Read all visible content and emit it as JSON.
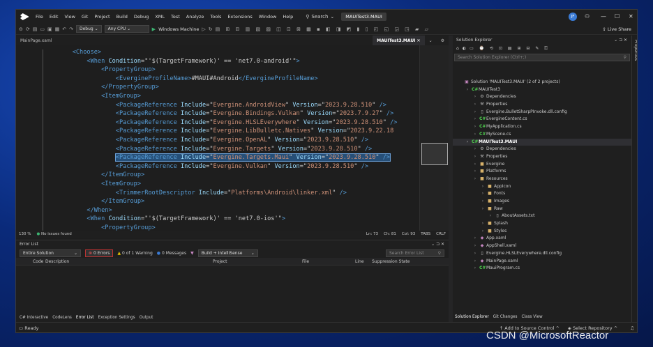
{
  "title_bar": {
    "menu": [
      "File",
      "Edit",
      "View",
      "Git",
      "Project",
      "Build",
      "Debug",
      "XML",
      "Test",
      "Analyze",
      "Tools",
      "Extensions",
      "Window",
      "Help"
    ],
    "search_label": "Search",
    "project_title": "MAUITest3.MAUI",
    "avatar_initials": "JF"
  },
  "toolbar": {
    "config": "Debug",
    "platform": "Any CPU",
    "run_target": "Windows Machine",
    "live_share": "Live Share"
  },
  "tabs": {
    "left": "MainPage.xaml",
    "active": "MAUITest3.MAUI"
  },
  "editor": {
    "lines": [
      {
        "indent": "    ",
        "tokens": [
          {
            "c": "t",
            "v": "<Choose>"
          }
        ]
      },
      {
        "indent": "        ",
        "tokens": [
          {
            "c": "t",
            "v": "<When "
          },
          {
            "c": "a",
            "v": "Condition"
          },
          {
            "c": "x",
            "v": "=\""
          },
          {
            "c": "x",
            "v": "'$(TargetFramework)' == 'net7.0-android'"
          },
          {
            "c": "x",
            "v": "\""
          },
          {
            "c": "t",
            "v": ">"
          }
        ]
      },
      {
        "indent": "            ",
        "tokens": [
          {
            "c": "t",
            "v": "<PropertyGroup>"
          }
        ]
      },
      {
        "indent": "                ",
        "tokens": [
          {
            "c": "t",
            "v": "<EvergineProfileName>"
          },
          {
            "c": "x",
            "v": "#MAUI#Android"
          },
          {
            "c": "t",
            "v": "</EvergineProfileName>"
          }
        ]
      },
      {
        "indent": "            ",
        "tokens": [
          {
            "c": "t",
            "v": "</PropertyGroup>"
          }
        ]
      },
      {
        "indent": "            ",
        "tokens": [
          {
            "c": "t",
            "v": "<ItemGroup>"
          }
        ]
      },
      {
        "indent": "                ",
        "tokens": [
          {
            "c": "t",
            "v": "<PackageReference "
          },
          {
            "c": "a",
            "v": "Include"
          },
          {
            "c": "x",
            "v": "=\""
          },
          {
            "c": "x",
            "v": "Evergine.AndroidView"
          },
          {
            "c": "x",
            "v": "\" "
          },
          {
            "c": "a",
            "v": "Version"
          },
          {
            "c": "x",
            "v": "=\""
          },
          {
            "c": "x",
            "v": "2023.9.28.510"
          },
          {
            "c": "x",
            "v": "\" "
          },
          {
            "c": "t",
            "v": "/>"
          }
        ]
      },
      {
        "indent": "                ",
        "tokens": [
          {
            "c": "t",
            "v": "<PackageReference "
          },
          {
            "c": "a",
            "v": "Include"
          },
          {
            "c": "x",
            "v": "=\""
          },
          {
            "c": "x",
            "v": "Evergine.Bindings.Vulkan"
          },
          {
            "c": "x",
            "v": "\" "
          },
          {
            "c": "a",
            "v": "Version"
          },
          {
            "c": "x",
            "v": "=\""
          },
          {
            "c": "x",
            "v": "2023.7.9.27"
          },
          {
            "c": "x",
            "v": "\" "
          },
          {
            "c": "t",
            "v": "/>"
          }
        ]
      },
      {
        "indent": "                ",
        "tokens": [
          {
            "c": "t",
            "v": "<PackageReference "
          },
          {
            "c": "a",
            "v": "Include"
          },
          {
            "c": "x",
            "v": "=\""
          },
          {
            "c": "x",
            "v": "Evergine.HLSLEverywhere"
          },
          {
            "c": "x",
            "v": "\" "
          },
          {
            "c": "a",
            "v": "Version"
          },
          {
            "c": "x",
            "v": "=\""
          },
          {
            "c": "x",
            "v": "2023.9.28.510"
          },
          {
            "c": "x",
            "v": "\" "
          },
          {
            "c": "t",
            "v": "/>"
          }
        ]
      },
      {
        "indent": "                ",
        "tokens": [
          {
            "c": "t",
            "v": "<PackageReference "
          },
          {
            "c": "a",
            "v": "Include"
          },
          {
            "c": "x",
            "v": "=\""
          },
          {
            "c": "x",
            "v": "Evergine.LibBulletc.Natives"
          },
          {
            "c": "x",
            "v": "\" "
          },
          {
            "c": "a",
            "v": "Version"
          },
          {
            "c": "x",
            "v": "=\""
          },
          {
            "c": "x",
            "v": "2023.9.22.18"
          }
        ]
      },
      {
        "indent": "                ",
        "tokens": [
          {
            "c": "t",
            "v": "<PackageReference "
          },
          {
            "c": "a",
            "v": "Include"
          },
          {
            "c": "x",
            "v": "=\""
          },
          {
            "c": "x",
            "v": "Evergine.OpenAL"
          },
          {
            "c": "x",
            "v": "\" "
          },
          {
            "c": "a",
            "v": "Version"
          },
          {
            "c": "x",
            "v": "=\""
          },
          {
            "c": "x",
            "v": "2023.9.28.510"
          },
          {
            "c": "x",
            "v": "\" "
          },
          {
            "c": "t",
            "v": "/>"
          }
        ]
      },
      {
        "indent": "                ",
        "tokens": [
          {
            "c": "t",
            "v": "<PackageReference "
          },
          {
            "c": "a",
            "v": "Include"
          },
          {
            "c": "x",
            "v": "=\""
          },
          {
            "c": "x",
            "v": "Evergine.Targets"
          },
          {
            "c": "x",
            "v": "\" "
          },
          {
            "c": "a",
            "v": "Version"
          },
          {
            "c": "x",
            "v": "=\""
          },
          {
            "c": "x",
            "v": "2023.9.28.510"
          },
          {
            "c": "x",
            "v": "\" "
          },
          {
            "c": "t",
            "v": "/>"
          }
        ]
      },
      {
        "indent": "                ",
        "selected": true,
        "tokens": [
          {
            "c": "t",
            "v": "<PackageReference "
          },
          {
            "c": "a",
            "v": "Include"
          },
          {
            "c": "x",
            "v": "=\""
          },
          {
            "c": "x",
            "v": "Evergine.Targets.Maui"
          },
          {
            "c": "x",
            "v": "\" "
          },
          {
            "c": "a",
            "v": "Version"
          },
          {
            "c": "x",
            "v": "=\""
          },
          {
            "c": "x",
            "v": "2023.9.28.510"
          },
          {
            "c": "x",
            "v": "\" "
          },
          {
            "c": "t",
            "v": "/>"
          }
        ]
      },
      {
        "indent": "                ",
        "tokens": [
          {
            "c": "t",
            "v": "<PackageReference "
          },
          {
            "c": "a",
            "v": "Include"
          },
          {
            "c": "x",
            "v": "=\""
          },
          {
            "c": "x",
            "v": "Evergine.Vulkan"
          },
          {
            "c": "x",
            "v": "\" "
          },
          {
            "c": "a",
            "v": "Version"
          },
          {
            "c": "x",
            "v": "=\""
          },
          {
            "c": "x",
            "v": "2023.9.28.510"
          },
          {
            "c": "x",
            "v": "\" "
          },
          {
            "c": "t",
            "v": "/>"
          }
        ]
      },
      {
        "indent": "            ",
        "tokens": [
          {
            "c": "t",
            "v": "</ItemGroup>"
          }
        ]
      },
      {
        "indent": "            ",
        "tokens": [
          {
            "c": "t",
            "v": "<ItemGroup>"
          }
        ]
      },
      {
        "indent": "                ",
        "tokens": [
          {
            "c": "t",
            "v": "<TrimmerRootDescriptor "
          },
          {
            "c": "a",
            "v": "Include"
          },
          {
            "c": "x",
            "v": "=\""
          },
          {
            "c": "x",
            "v": "Platforms\\Android\\linker.xml"
          },
          {
            "c": "x",
            "v": "\" "
          },
          {
            "c": "t",
            "v": "/>"
          }
        ]
      },
      {
        "indent": "            ",
        "tokens": [
          {
            "c": "t",
            "v": "</ItemGroup>"
          }
        ]
      },
      {
        "indent": "        ",
        "tokens": [
          {
            "c": "t",
            "v": "</When>"
          }
        ]
      },
      {
        "indent": "        ",
        "tokens": [
          {
            "c": "t",
            "v": "<When "
          },
          {
            "c": "a",
            "v": "Condition"
          },
          {
            "c": "x",
            "v": "=\""
          },
          {
            "c": "x",
            "v": "'$(TargetFramework)' == 'net7.0-ios'"
          },
          {
            "c": "x",
            "v": "\""
          },
          {
            "c": "t",
            "v": ">"
          }
        ]
      },
      {
        "indent": "            ",
        "tokens": [
          {
            "c": "t",
            "v": "<PropertyGroup>"
          }
        ]
      }
    ],
    "zoom": "130 %",
    "issues": "No issues found",
    "ln": "Ln: 73",
    "ch": "Ch: 81",
    "col": "Col: 93",
    "tabs": "TABS",
    "eol": "CRLF"
  },
  "error_list": {
    "title": "Error List",
    "scope": "Entire Solution",
    "errors": "0 Errors",
    "warnings": "0 of 1 Warning",
    "messages": "0 Messages",
    "build_filter": "Build + IntelliSense",
    "search_placeholder": "Search Error List",
    "columns": [
      "Code",
      "Description",
      "Project",
      "File",
      "Line",
      "Suppression State"
    ],
    "bottom_tabs": [
      "C# Interactive",
      "CodeLens",
      "Error List",
      "Exception Settings",
      "Output"
    ]
  },
  "solution_explorer": {
    "title": "Solution Explorer",
    "search_placeholder": "Search Solution Explorer (Ctrl+;)",
    "items": [
      {
        "label": "Solution 'MAUITest3.MAUI' (2 of 2 projects)",
        "depth": 0,
        "icon": "▣",
        "color": "#c586c0"
      },
      {
        "label": "MAUITest3",
        "depth": 1,
        "icon": "C#",
        "color": "#4ec94e"
      },
      {
        "label": "Dependencies",
        "depth": 2,
        "icon": "⚙",
        "color": "#bbb"
      },
      {
        "label": "Properties",
        "depth": 2,
        "icon": "🔧",
        "color": "#bbb"
      },
      {
        "label": "Evergine.BulletSharpPInvoke.dll.config",
        "depth": 2,
        "icon": "▯",
        "color": "#bbb"
      },
      {
        "label": "EvergineContent.cs",
        "depth": 2,
        "icon": "C#",
        "color": "#4ec94e"
      },
      {
        "label": "MyApplication.cs",
        "depth": 2,
        "icon": "C#",
        "color": "#4ec94e"
      },
      {
        "label": "MyScene.cs",
        "depth": 2,
        "icon": "C#",
        "color": "#4ec94e"
      },
      {
        "label": "MAUITest3.MAUI",
        "depth": 1,
        "icon": "C#",
        "color": "#4ec94e",
        "bold": true
      },
      {
        "label": "Dependencies",
        "depth": 2,
        "icon": "⚙",
        "color": "#bbb"
      },
      {
        "label": "Properties",
        "depth": 2,
        "icon": "🔧",
        "color": "#bbb"
      },
      {
        "label": "Evergine",
        "depth": 2,
        "icon": "■",
        "color": "#d8b26a"
      },
      {
        "label": "Platforms",
        "depth": 2,
        "icon": "■",
        "color": "#d8b26a"
      },
      {
        "label": "Resources",
        "depth": 2,
        "icon": "■",
        "color": "#d8b26a"
      },
      {
        "label": "AppIcon",
        "depth": 3,
        "icon": "■",
        "color": "#d8b26a"
      },
      {
        "label": "Fonts",
        "depth": 3,
        "icon": "■",
        "color": "#d8b26a"
      },
      {
        "label": "Images",
        "depth": 3,
        "icon": "■",
        "color": "#d8b26a"
      },
      {
        "label": "Raw",
        "depth": 3,
        "icon": "■",
        "color": "#d8b26a"
      },
      {
        "label": "AboutAssets.txt",
        "depth": 4,
        "icon": "▯",
        "color": "#bbb"
      },
      {
        "label": "Splash",
        "depth": 3,
        "icon": "■",
        "color": "#d8b26a"
      },
      {
        "label": "Styles",
        "depth": 3,
        "icon": "■",
        "color": "#d8b26a"
      },
      {
        "label": "App.xaml",
        "depth": 2,
        "icon": "◆",
        "color": "#c586c0"
      },
      {
        "label": "AppShell.xaml",
        "depth": 2,
        "icon": "◆",
        "color": "#c586c0"
      },
      {
        "label": "Evergine.HLSLEverywhere.dll.config",
        "depth": 2,
        "icon": "▯",
        "color": "#bbb"
      },
      {
        "label": "MainPage.xaml",
        "depth": 2,
        "icon": "◆",
        "color": "#c586c0"
      },
      {
        "label": "MauiProgram.cs",
        "depth": 2,
        "icon": "C#",
        "color": "#4ec94e"
      }
    ],
    "bottom_tabs": [
      "Solution Explorer",
      "Git Changes",
      "Class View"
    ],
    "properties_tab": "Properties"
  },
  "status_bar": {
    "ready": "Ready",
    "source_control": "Add to Source Control",
    "repository": "Select Repository"
  },
  "watermark": "CSDN @MicrosoftReactor"
}
